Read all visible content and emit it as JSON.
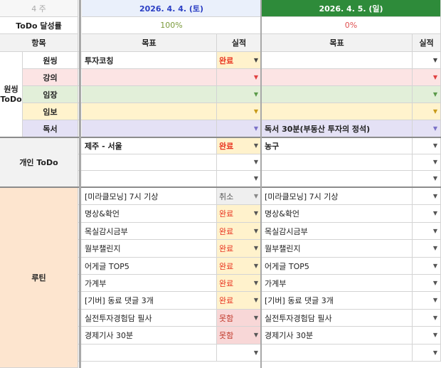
{
  "header": {
    "week_label": "4 주",
    "day1": "2026. 4. 4. (토)",
    "day2": "2026. 4. 5. (일)",
    "achievement_label": "ToDo 달성률",
    "day1_rate": "100%",
    "day2_rate": "0%",
    "item_label": "항목",
    "goal_label": "목표",
    "result_label": "실적"
  },
  "sections": {
    "wonsing": "원씽\nToDo",
    "personal": "개인 ToDo",
    "routine": "루틴"
  },
  "wonsing_rows": [
    {
      "category": "원씽",
      "bg": "#ffffff",
      "g1": "투자코칭",
      "r1": "완료",
      "g2": "",
      "arrow": "#444444"
    },
    {
      "category": "강의",
      "bg": "#fce4e4",
      "g1": "",
      "r1": "",
      "g2": "",
      "arrow": "#e04040"
    },
    {
      "category": "임장",
      "bg": "#e2efd9",
      "g1": "",
      "r1": "",
      "g2": "",
      "arrow": "#5a9a4a"
    },
    {
      "category": "임보",
      "bg": "#fff3cd",
      "g1": "",
      "r1": "",
      "g2": "",
      "arrow": "#c89a1a"
    },
    {
      "category": "독서",
      "bg": "#e4e1f5",
      "g1": "",
      "r1": "",
      "g2": "독서 30분(부동산 투자의 정석)",
      "arrow": "#7b72c8"
    }
  ],
  "personal_rows": [
    {
      "g1": "제주 - 서울",
      "r1": "완료",
      "g2": "농구"
    },
    {
      "g1": "",
      "r1": "",
      "g2": ""
    },
    {
      "g1": "",
      "r1": "",
      "g2": ""
    }
  ],
  "routine_rows": [
    {
      "g1": "[미라클모닝] 7시 기상",
      "r1": "취소",
      "g2": "[미라클모닝] 7시 기상"
    },
    {
      "g1": "명상&확언",
      "r1": "완료",
      "g2": "명상&확언"
    },
    {
      "g1": "목실감시금부",
      "r1": "완료",
      "g2": "목실감시금부"
    },
    {
      "g1": "월부챌린지",
      "r1": "완료",
      "g2": "월부챌린지"
    },
    {
      "g1": "어게글 TOP5",
      "r1": "완료",
      "g2": "어게글 TOP5"
    },
    {
      "g1": "가계부",
      "r1": "완료",
      "g2": "가계부"
    },
    {
      "g1": "[기버] 동료 댓글 3개",
      "r1": "완료",
      "g2": "[기버] 동료 댓글 3개"
    },
    {
      "g1": "실전투자경험담 필사",
      "r1": "못함",
      "g2": "실전투자경험담 필사"
    },
    {
      "g1": "경제기사 30분",
      "r1": "못함",
      "g2": "경제기사 30분"
    },
    {
      "g1": "",
      "r1": "",
      "g2": ""
    }
  ],
  "status_styles": {
    "완료": {
      "bg": "#fff2cc",
      "color": "#e8321e"
    },
    "취소": {
      "bg": "#efefef",
      "color": "#555555"
    },
    "못함": {
      "bg": "#f8d7d7",
      "color": "#c0392b"
    }
  },
  "icons": {
    "dropdown": "dropdown-arrow-icon"
  },
  "colors": {
    "day1_header_bg": "#eaf0fb",
    "day1_header_text": "#2b3fc4",
    "day2_header_bg": "#2e8b3a",
    "day2_header_text": "#ffffff",
    "rate_text": "#7a9a3a",
    "rate2_text": "#e05050",
    "section_gray": "#f2f2f2",
    "routine_bg": "#fde5cf",
    "label_pink": "#f3d9e5"
  }
}
